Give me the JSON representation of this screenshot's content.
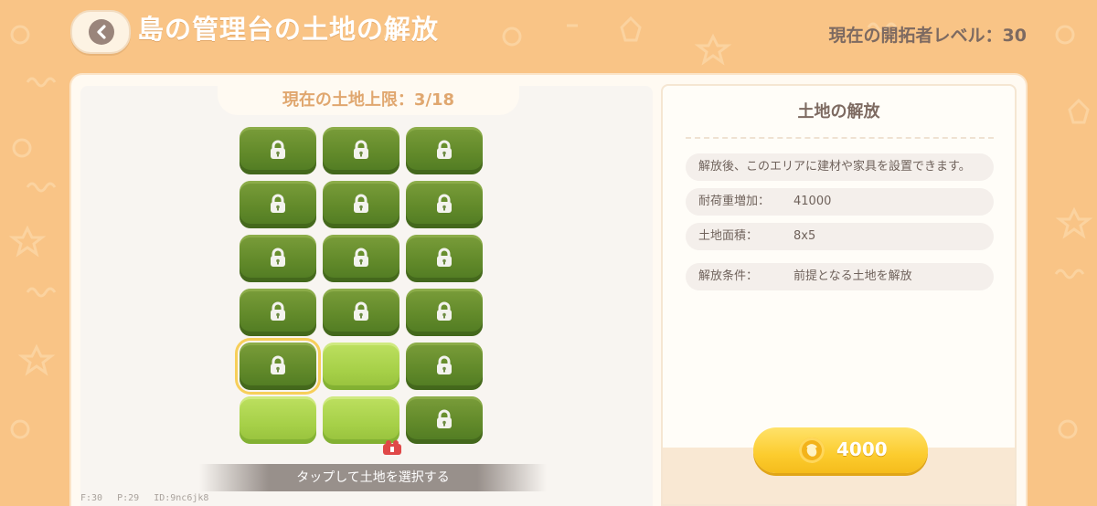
{
  "header": {
    "title": "島の管理台の土地の解放",
    "level": "現在の開拓者レベル：30"
  },
  "land_grid": {
    "limit": "現在の土地上限：3/18",
    "tap_hint": "タップして土地を選択する",
    "debug": "F:30 P:29 ID:9nc6jk8",
    "tiles": [
      "locked",
      "locked",
      "locked",
      "locked",
      "locked",
      "locked",
      "locked",
      "locked",
      "locked",
      "locked",
      "locked",
      "locked",
      "locked-selected",
      "unlocked",
      "locked",
      "unlocked",
      "unlocked",
      "locked"
    ]
  },
  "detail": {
    "title": "土地の解放",
    "description": "解放後、このエリアに建材や家具を設置できます。",
    "rows": [
      {
        "label": "耐荷重増加：",
        "value": "41000"
      },
      {
        "label": "土地面積：",
        "value": "8x5"
      },
      {
        "label": "解放条件：",
        "value": "前提となる土地を解放"
      }
    ],
    "cost": "4000"
  },
  "colors": {
    "background": "#f9c486",
    "locked_tile": "#628a2a",
    "unlocked_tile": "#a6d048",
    "selected_outline": "#f7cf5a",
    "cost_button": "#fccc2e"
  }
}
